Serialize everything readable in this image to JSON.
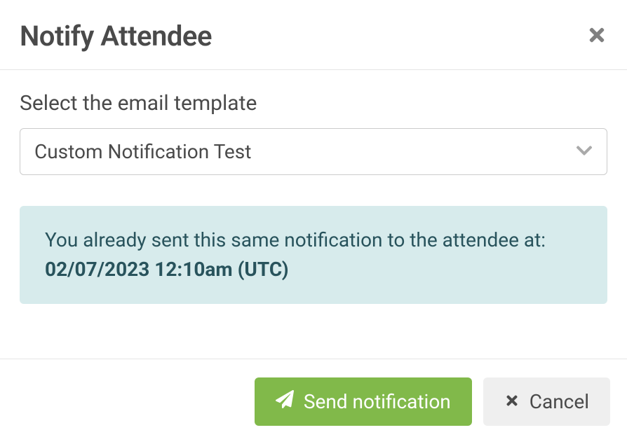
{
  "modal": {
    "title": "Notify Attendee"
  },
  "form": {
    "template_label": "Select the email template",
    "template_selected": "Custom Notification Test"
  },
  "info": {
    "message_prefix": "You already sent this same notification to the attendee at: ",
    "timestamp": "02/07/2023 12:10am (UTC)"
  },
  "actions": {
    "send_label": "Send notification",
    "cancel_label": "Cancel"
  }
}
